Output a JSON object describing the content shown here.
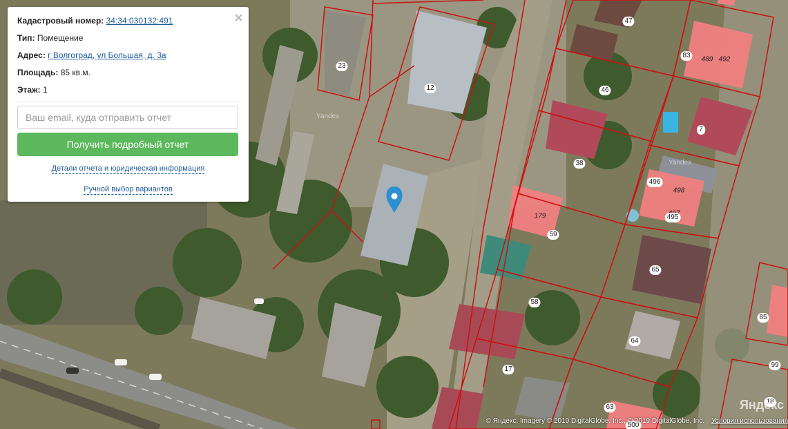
{
  "panel": {
    "close_icon": "×",
    "cadastral_label": "Кадастровый номер:",
    "cadastral_value": "34:34:030132:491",
    "type_label": "Тип:",
    "type_value": "Помещение",
    "address_label": "Адрес:",
    "address_value": "г Волгоград, ул Большая, д. 3а",
    "area_label": "Площадь:",
    "area_value": "85 кв.м.",
    "floor_label": "Этаж:",
    "floor_value": "1",
    "email_placeholder": "Ваш email, куда отправить отчет",
    "submit_label": "Получить подробный отчет",
    "details_link": "Детали отчета и юридическая информация",
    "manual_link": "Ручной выбор вариантов"
  },
  "parcel_numbers": [
    "47",
    "83",
    "489",
    "492",
    "23",
    "12",
    "46",
    "7",
    "38",
    "496",
    "498",
    "497",
    "495",
    "179",
    "59",
    "65",
    "58",
    "64",
    "85",
    "17",
    "99",
    "63",
    "500",
    "18"
  ],
  "watermarks": [
    "Yandex",
    "Yandex"
  ],
  "logo": "Яндекс",
  "attribution": {
    "text": "© Яндекс, Imagery © 2019 DigitalGlobe, Inc., © 2019 DigitalGlobe, Inc.",
    "terms": "Условия использования"
  },
  "colors": {
    "button": "#5cb85c",
    "link": "#1d5d9b",
    "parcel_border": "#cc1111",
    "highlight_fill": "#f08080",
    "marker": "#2b8fd0"
  }
}
